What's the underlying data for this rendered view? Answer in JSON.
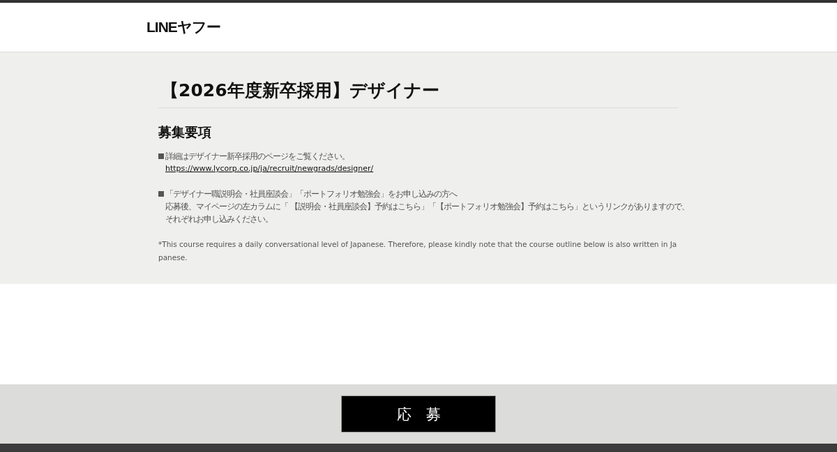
{
  "header": {
    "logo": "LINEヤフー"
  },
  "job": {
    "title": "【2026年度新卒採用】デザイナー",
    "section_heading": "募集要項",
    "blocks": [
      {
        "lines": [
          "詳細はデザイナー新卒採用のページをご覧ください。"
        ],
        "link": "https://www.lycorp.co.jp/ja/recruit/newgrads/designer/"
      },
      {
        "lines": [
          "「デザイナー職説明会・社員座談会」「ポートフォリオ勉強会」をお申し込みの方へ",
          "応募後、マイページの左カラムに「 【説明会・社員座談会】予約はこちら」「【ポートフォリオ勉強会】予約はこちら」というリンクがありますので、",
          "それぞれお申し込みください。"
        ]
      }
    ],
    "note": "*This course requires a daily conversational level of Japanese. Therefore, please kindly note that the course outline below is also written in Japanese."
  },
  "footer": {
    "apply_button": "応　募"
  }
}
